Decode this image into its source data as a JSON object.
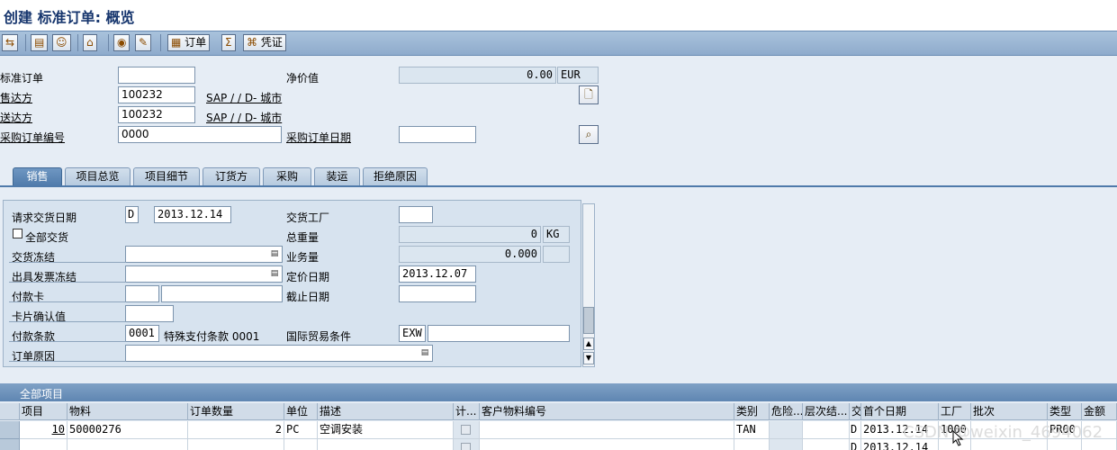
{
  "title": "创建 标准订单: 概览",
  "toolbar": {
    "items_label": "订单",
    "doc_flow_label": "凭证"
  },
  "header": {
    "std_order_label": "标准订单",
    "std_order_value": "",
    "net_value_label": "净价值",
    "net_value": "0.00",
    "currency": "EUR",
    "sold_to_label": "售达方",
    "sold_to_value": "100232",
    "sold_to_desc": "SAP / / D- 城市",
    "ship_to_label": "送达方",
    "ship_to_value": "100232",
    "ship_to_desc": "SAP / / D- 城市",
    "po_number_label": "采购订单编号",
    "po_number_value": "0000",
    "po_date_label": "采购订单日期",
    "po_date_value": ""
  },
  "tabs": [
    "销售",
    "项目总览",
    "项目细节",
    "订货方",
    "采购",
    "装运",
    "拒绝原因"
  ],
  "sales": {
    "req_delivery_date_label": "请求交货日期",
    "req_delivery_date_type": "D",
    "req_delivery_date": "2013.12.14",
    "delivering_plant_label": "交货工厂",
    "delivering_plant": "",
    "complete_delivery_label": "全部交货",
    "total_weight_label": "总重量",
    "total_weight": "0",
    "weight_unit": "KG",
    "delivery_block_label": "交货冻结",
    "delivery_block": "",
    "volume_label": "业务量",
    "volume": "0.000",
    "volume_unit": "",
    "billing_block_label": "出具发票冻结",
    "billing_block": "",
    "pricing_date_label": "定价日期",
    "pricing_date": "2013.12.07",
    "payment_card_label": "付款卡",
    "payment_card_type": "",
    "payment_card_number": "",
    "expiry_date_label": "截止日期",
    "expiry_date": "",
    "card_verif_label": "卡片确认值",
    "card_verif": "",
    "payment_terms_label": "付款条款",
    "payment_terms": "0001",
    "payment_terms_desc": "特殊支付条款 0001",
    "incoterms_label": "国际贸易条件",
    "incoterms": "EXW",
    "incoterms2": "",
    "order_reason_label": "订单原因",
    "order_reason": ""
  },
  "items": {
    "title": "全部项目",
    "columns": [
      "项目",
      "物料",
      "订单数量",
      "单位",
      "描述",
      "计...",
      "客户物料编号",
      "类别",
      "危险...",
      "层次结...",
      "交",
      "首个日期",
      "工厂",
      "批次",
      "类型",
      "金额"
    ],
    "rows": [
      {
        "item": "10",
        "material": "50000276",
        "qty": "2",
        "unit": "PC",
        "desc": "空调安装",
        "category": "TAN",
        "d": "D",
        "first_date": "2013.12.14",
        "plant": "1000",
        "batch": "",
        "type": "PR00"
      },
      {
        "item": "",
        "material": "",
        "qty": "",
        "unit": "",
        "desc": "",
        "category": "",
        "d": "D",
        "first_date": "2013.12.14",
        "plant": "",
        "batch": "",
        "type": ""
      }
    ]
  },
  "watermark": "CSDN @weixin_4694062",
  "colors": {
    "accent": "#4f7aaa",
    "title": "#17366e"
  }
}
